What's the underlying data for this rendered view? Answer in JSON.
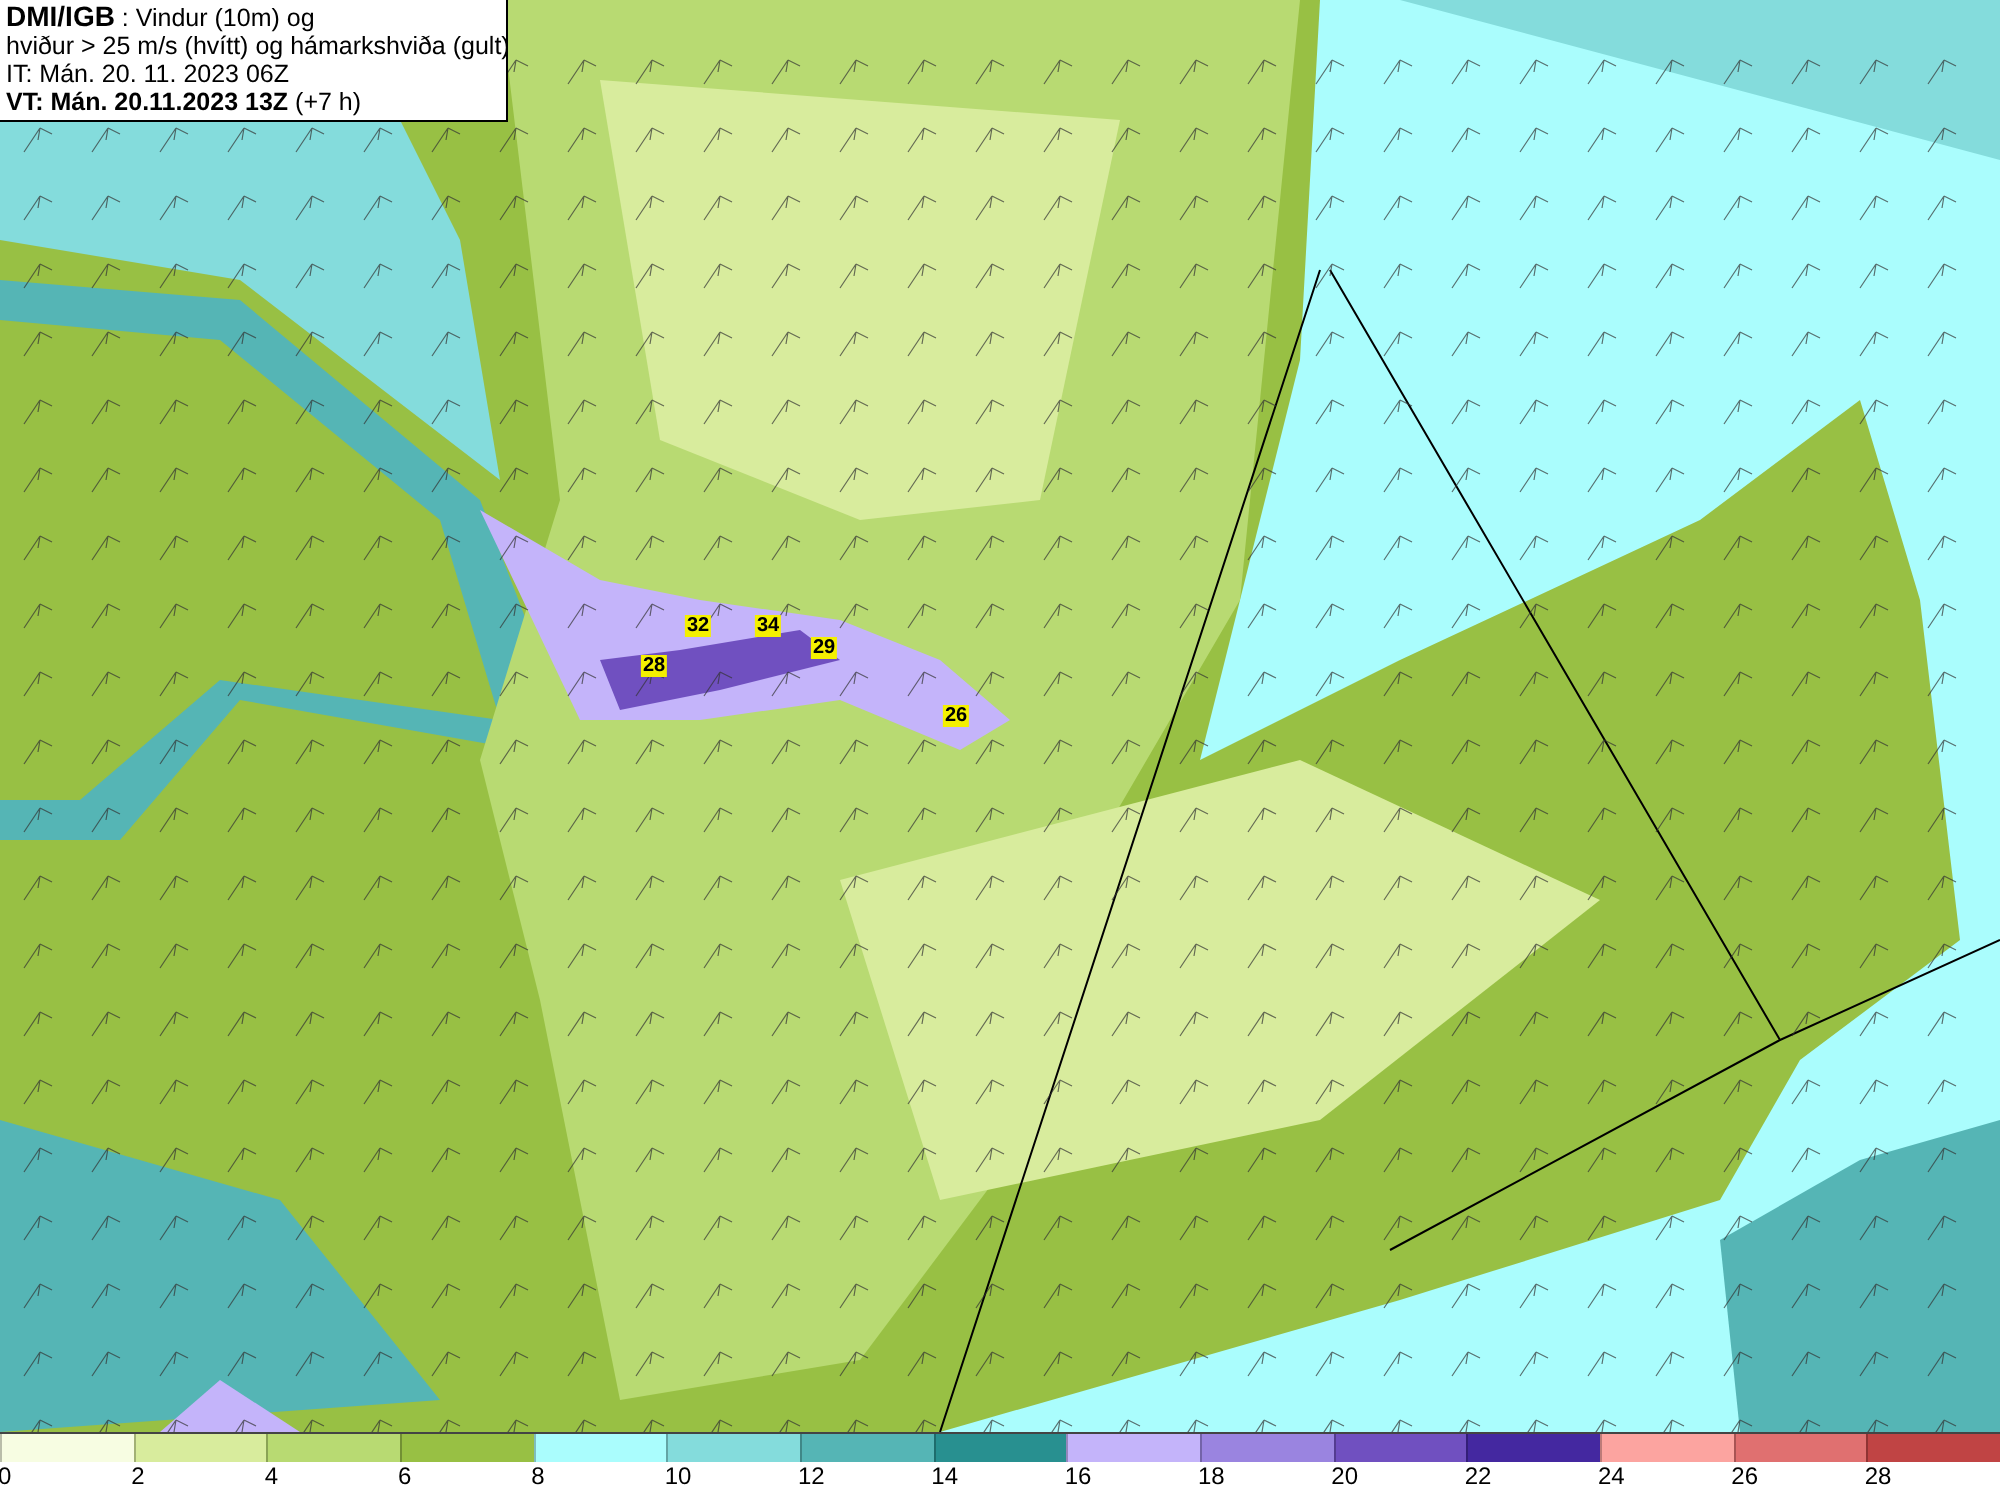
{
  "title_box": {
    "source": "DMI/IGB",
    "title_rest": " : Vindur (10m) og",
    "subtitle": "hviður > 25 m/s (hvítt) og hámarkshviða (gult)",
    "issue_time": "IT: Mán. 20. 11. 2023 06Z",
    "valid_time": "VT: Mán. 20.11.2023 13Z",
    "lead": " (+7 h)"
  },
  "gust_labels": [
    "32",
    "34",
    "29",
    "28",
    "26"
  ],
  "legend": [
    {
      "label": "0",
      "color": "#f7fde2"
    },
    {
      "label": "2",
      "color": "#d8ec9d"
    },
    {
      "label": "4",
      "color": "#b8da72"
    },
    {
      "label": "6",
      "color": "#98c044"
    },
    {
      "label": "8",
      "color": "#aafdfd"
    },
    {
      "label": "10",
      "color": "#84dcdc"
    },
    {
      "label": "12",
      "color": "#55b5b5"
    },
    {
      "label": "14",
      "color": "#289090"
    },
    {
      "label": "16",
      "color": "#c4b4fa"
    },
    {
      "label": "18",
      "color": "#9a84e0"
    },
    {
      "label": "20",
      "color": "#7050c0"
    },
    {
      "label": "22",
      "color": "#4428a0"
    },
    {
      "label": "24",
      "color": "#fca4a0"
    },
    {
      "label": "26",
      "color": "#e07070"
    },
    {
      "label": "28",
      "color": "#c04444"
    }
  ]
}
